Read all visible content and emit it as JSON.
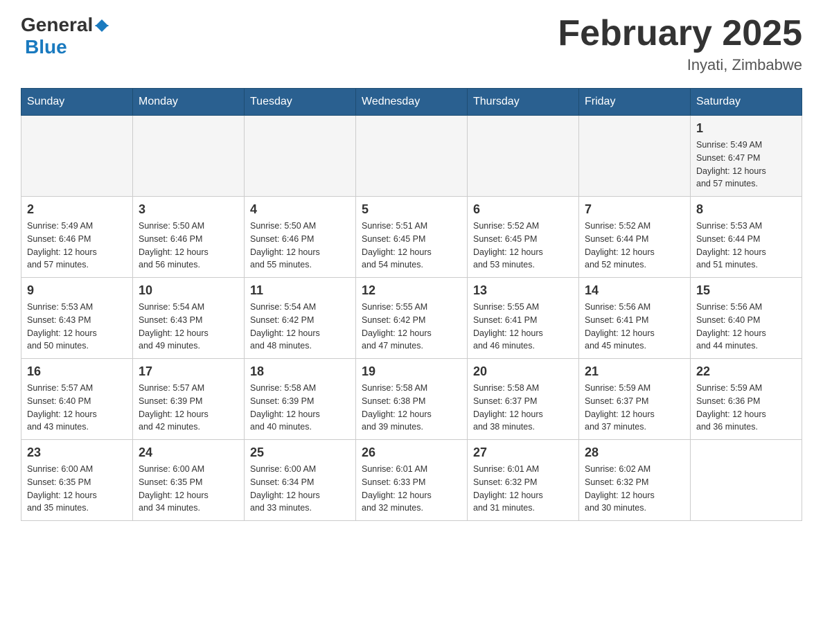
{
  "header": {
    "logo_general": "General",
    "logo_blue": "Blue",
    "month_title": "February 2025",
    "location": "Inyati, Zimbabwe"
  },
  "days_of_week": [
    "Sunday",
    "Monday",
    "Tuesday",
    "Wednesday",
    "Thursday",
    "Friday",
    "Saturday"
  ],
  "weeks": [
    {
      "days": [
        {
          "number": "",
          "info": ""
        },
        {
          "number": "",
          "info": ""
        },
        {
          "number": "",
          "info": ""
        },
        {
          "number": "",
          "info": ""
        },
        {
          "number": "",
          "info": ""
        },
        {
          "number": "",
          "info": ""
        },
        {
          "number": "1",
          "info": "Sunrise: 5:49 AM\nSunset: 6:47 PM\nDaylight: 12 hours\nand 57 minutes."
        }
      ]
    },
    {
      "days": [
        {
          "number": "2",
          "info": "Sunrise: 5:49 AM\nSunset: 6:46 PM\nDaylight: 12 hours\nand 57 minutes."
        },
        {
          "number": "3",
          "info": "Sunrise: 5:50 AM\nSunset: 6:46 PM\nDaylight: 12 hours\nand 56 minutes."
        },
        {
          "number": "4",
          "info": "Sunrise: 5:50 AM\nSunset: 6:46 PM\nDaylight: 12 hours\nand 55 minutes."
        },
        {
          "number": "5",
          "info": "Sunrise: 5:51 AM\nSunset: 6:45 PM\nDaylight: 12 hours\nand 54 minutes."
        },
        {
          "number": "6",
          "info": "Sunrise: 5:52 AM\nSunset: 6:45 PM\nDaylight: 12 hours\nand 53 minutes."
        },
        {
          "number": "7",
          "info": "Sunrise: 5:52 AM\nSunset: 6:44 PM\nDaylight: 12 hours\nand 52 minutes."
        },
        {
          "number": "8",
          "info": "Sunrise: 5:53 AM\nSunset: 6:44 PM\nDaylight: 12 hours\nand 51 minutes."
        }
      ]
    },
    {
      "days": [
        {
          "number": "9",
          "info": "Sunrise: 5:53 AM\nSunset: 6:43 PM\nDaylight: 12 hours\nand 50 minutes."
        },
        {
          "number": "10",
          "info": "Sunrise: 5:54 AM\nSunset: 6:43 PM\nDaylight: 12 hours\nand 49 minutes."
        },
        {
          "number": "11",
          "info": "Sunrise: 5:54 AM\nSunset: 6:42 PM\nDaylight: 12 hours\nand 48 minutes."
        },
        {
          "number": "12",
          "info": "Sunrise: 5:55 AM\nSunset: 6:42 PM\nDaylight: 12 hours\nand 47 minutes."
        },
        {
          "number": "13",
          "info": "Sunrise: 5:55 AM\nSunset: 6:41 PM\nDaylight: 12 hours\nand 46 minutes."
        },
        {
          "number": "14",
          "info": "Sunrise: 5:56 AM\nSunset: 6:41 PM\nDaylight: 12 hours\nand 45 minutes."
        },
        {
          "number": "15",
          "info": "Sunrise: 5:56 AM\nSunset: 6:40 PM\nDaylight: 12 hours\nand 44 minutes."
        }
      ]
    },
    {
      "days": [
        {
          "number": "16",
          "info": "Sunrise: 5:57 AM\nSunset: 6:40 PM\nDaylight: 12 hours\nand 43 minutes."
        },
        {
          "number": "17",
          "info": "Sunrise: 5:57 AM\nSunset: 6:39 PM\nDaylight: 12 hours\nand 42 minutes."
        },
        {
          "number": "18",
          "info": "Sunrise: 5:58 AM\nSunset: 6:39 PM\nDaylight: 12 hours\nand 40 minutes."
        },
        {
          "number": "19",
          "info": "Sunrise: 5:58 AM\nSunset: 6:38 PM\nDaylight: 12 hours\nand 39 minutes."
        },
        {
          "number": "20",
          "info": "Sunrise: 5:58 AM\nSunset: 6:37 PM\nDaylight: 12 hours\nand 38 minutes."
        },
        {
          "number": "21",
          "info": "Sunrise: 5:59 AM\nSunset: 6:37 PM\nDaylight: 12 hours\nand 37 minutes."
        },
        {
          "number": "22",
          "info": "Sunrise: 5:59 AM\nSunset: 6:36 PM\nDaylight: 12 hours\nand 36 minutes."
        }
      ]
    },
    {
      "days": [
        {
          "number": "23",
          "info": "Sunrise: 6:00 AM\nSunset: 6:35 PM\nDaylight: 12 hours\nand 35 minutes."
        },
        {
          "number": "24",
          "info": "Sunrise: 6:00 AM\nSunset: 6:35 PM\nDaylight: 12 hours\nand 34 minutes."
        },
        {
          "number": "25",
          "info": "Sunrise: 6:00 AM\nSunset: 6:34 PM\nDaylight: 12 hours\nand 33 minutes."
        },
        {
          "number": "26",
          "info": "Sunrise: 6:01 AM\nSunset: 6:33 PM\nDaylight: 12 hours\nand 32 minutes."
        },
        {
          "number": "27",
          "info": "Sunrise: 6:01 AM\nSunset: 6:32 PM\nDaylight: 12 hours\nand 31 minutes."
        },
        {
          "number": "28",
          "info": "Sunrise: 6:02 AM\nSunset: 6:32 PM\nDaylight: 12 hours\nand 30 minutes."
        },
        {
          "number": "",
          "info": ""
        }
      ]
    }
  ]
}
